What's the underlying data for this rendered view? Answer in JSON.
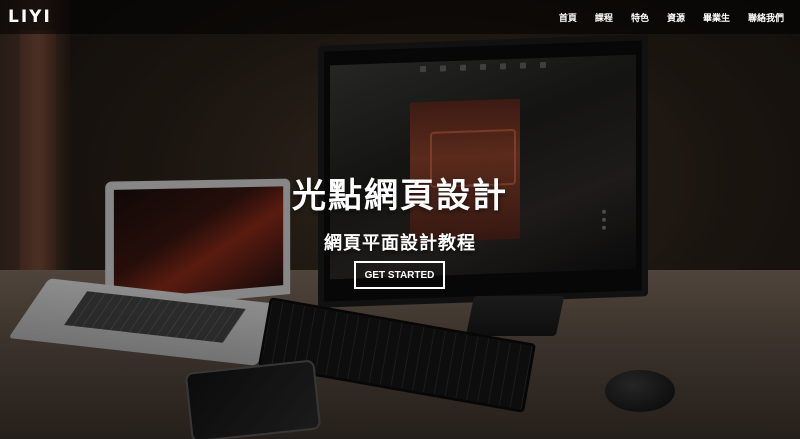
{
  "brand": {
    "name": "LIYI"
  },
  "nav": {
    "items": [
      {
        "label": "首頁"
      },
      {
        "label": "課程"
      },
      {
        "label": "特色"
      },
      {
        "label": "資源"
      },
      {
        "label": "畢業生"
      },
      {
        "label": "聯絡我們"
      }
    ]
  },
  "hero": {
    "title": "光點網頁設計",
    "subtitle": "網頁平面設計教程",
    "cta_label": "GET STARTED"
  },
  "colors": {
    "overlay": "#000000",
    "text": "#ffffff",
    "desk": "#5c4f44"
  }
}
